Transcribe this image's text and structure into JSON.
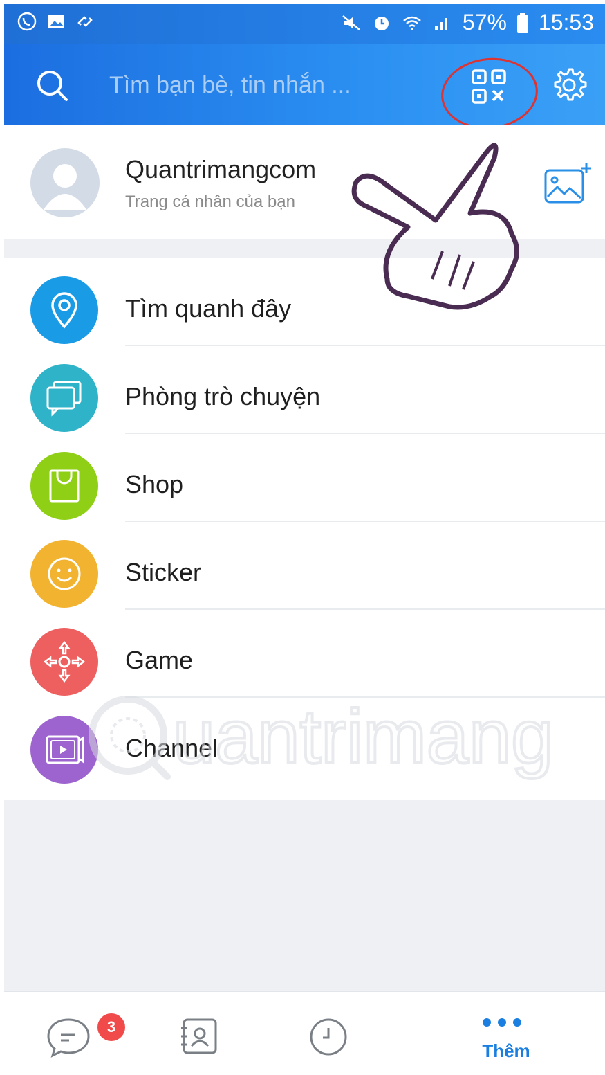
{
  "status_bar": {
    "battery": "57%",
    "time": "15:53"
  },
  "header": {
    "search_placeholder": "Tìm bạn bè, tin nhắn ..."
  },
  "profile": {
    "name": "Quantrimangcom",
    "subtitle": "Trang cá nhân của bạn"
  },
  "menu": {
    "items": [
      {
        "label": "Tìm quanh đây",
        "icon": "location-pin-icon",
        "color": "#1a9be6"
      },
      {
        "label": "Phòng trò chuyện",
        "icon": "chat-room-icon",
        "color": "#2fb3c8"
      },
      {
        "label": "Shop",
        "icon": "shopping-bag-icon",
        "color": "#8fcf16"
      },
      {
        "label": "Sticker",
        "icon": "smiley-icon",
        "color": "#f2b331"
      },
      {
        "label": "Game",
        "icon": "gamepad-icon",
        "color": "#ee5f5f"
      },
      {
        "label": "Channel",
        "icon": "video-channel-icon",
        "color": "#9d63cf"
      }
    ]
  },
  "tabbar": {
    "messages_badge": "3",
    "more_label": "Thêm"
  },
  "watermark": {
    "text": "Quantrimang"
  },
  "colors": {
    "header_start": "#1c6ee0",
    "header_end": "#3aa0f6",
    "accent": "#1a7fe0",
    "badge": "#f04a4a",
    "annotation_circle": "#d33333"
  }
}
